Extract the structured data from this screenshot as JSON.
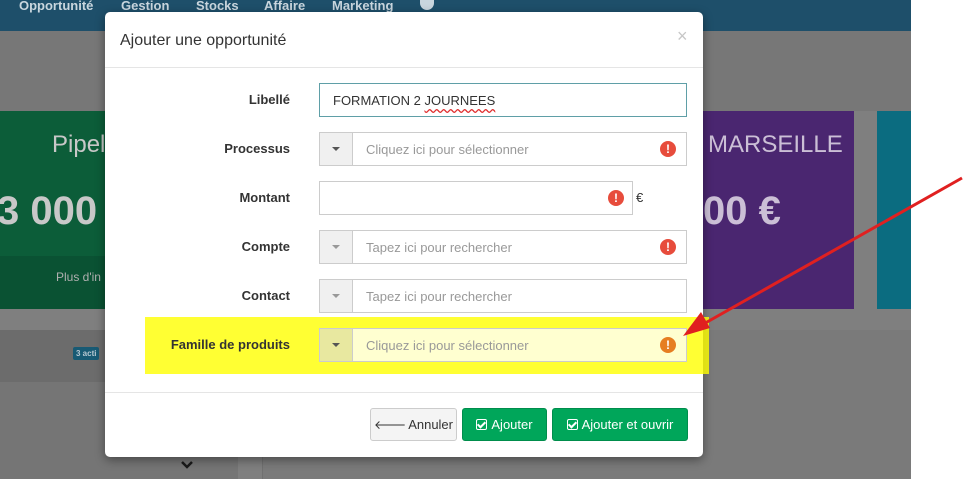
{
  "nav": {
    "items": [
      "Opportunité",
      "Gestion",
      "Stocks",
      "Affaire",
      "Marketing"
    ],
    "palette_icon": "palette-icon"
  },
  "tiles": {
    "green": {
      "title": "Pipel",
      "amount": "3 000",
      "more": "Plus d'in"
    },
    "purple": {
      "title": "MARSEILLE",
      "amount": "00 €"
    }
  },
  "background": {
    "badge": "3 acti"
  },
  "modal": {
    "title": "Ajouter une opportunité",
    "close": "×",
    "fields": {
      "libelle": {
        "label": "Libellé",
        "value": "FORMATION 2 JOURNEES",
        "value_prefix": "FORMATION 2 ",
        "value_misspelled": "JOURNEES"
      },
      "processus": {
        "label": "Processus",
        "placeholder": "Cliquez ici pour sélectionner"
      },
      "montant": {
        "label": "Montant",
        "value": "",
        "unit": "€"
      },
      "compte": {
        "label": "Compte",
        "placeholder": "Tapez ici pour rechercher"
      },
      "contact": {
        "label": "Contact",
        "placeholder": "Tapez ici pour rechercher"
      },
      "famille": {
        "label": "Famille de produits",
        "placeholder": "Cliquez ici pour sélectionner"
      }
    },
    "warning_glyph": "!",
    "buttons": {
      "cancel": "Annuler",
      "add": "Ajouter",
      "add_open": "Ajouter et ouvrir"
    }
  },
  "colors": {
    "navbar": "#1e4f6a",
    "primary_green": "#00a65a",
    "warning_red": "#e74c3c",
    "highlight": "#ffff00",
    "annotation_arrow": "#e02020"
  }
}
